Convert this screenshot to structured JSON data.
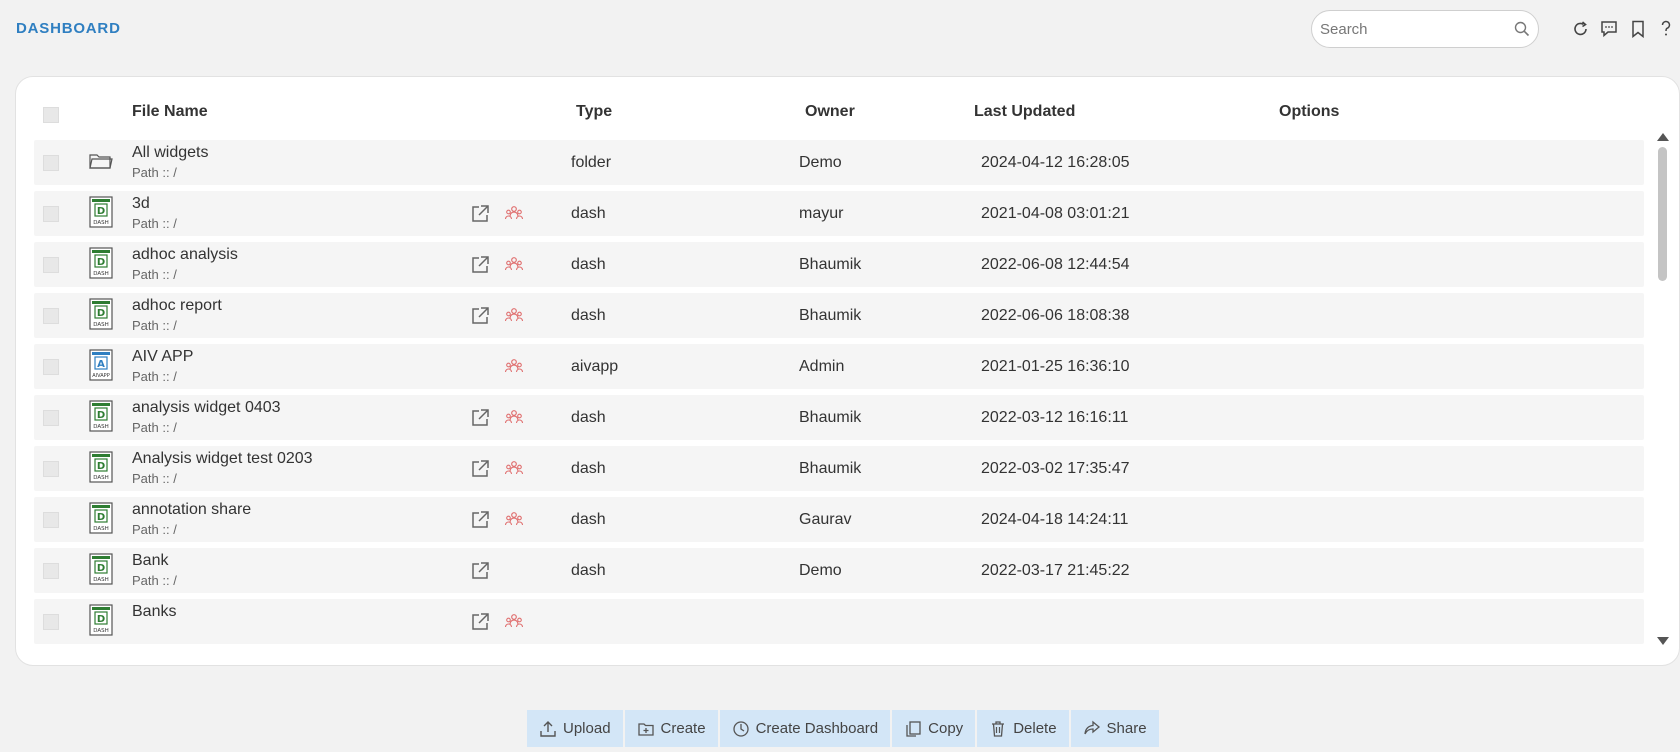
{
  "header": {
    "title": "DASHBOARD",
    "search_placeholder": "Search",
    "tools": [
      "refresh-icon",
      "comment-icon",
      "bookmark-icon",
      "help-icon"
    ]
  },
  "table": {
    "columns": {
      "file_name": "File Name",
      "type": "Type",
      "owner": "Owner",
      "last_updated": "Last Updated",
      "options": "Options"
    },
    "rows": [
      {
        "name": "All widgets",
        "path": "Path :: /",
        "type": "folder",
        "owner": "Demo",
        "updated": "2024-04-12 16:28:05",
        "icon": "folder-icon",
        "open": false,
        "share": false
      },
      {
        "name": "3d",
        "path": "Path :: /",
        "type": "dash",
        "owner": "mayur",
        "updated": "2021-04-08 03:01:21",
        "icon": "dash-file-icon",
        "open": true,
        "share": true
      },
      {
        "name": "adhoc analysis",
        "path": "Path :: /",
        "type": "dash",
        "owner": "Bhaumik",
        "updated": "2022-06-08 12:44:54",
        "icon": "dash-file-icon",
        "open": true,
        "share": true
      },
      {
        "name": "adhoc report",
        "path": "Path :: /",
        "type": "dash",
        "owner": "Bhaumik",
        "updated": "2022-06-06 18:08:38",
        "icon": "dash-file-icon",
        "open": true,
        "share": true
      },
      {
        "name": "AIV APP",
        "path": "Path :: /",
        "type": "aivapp",
        "owner": "Admin",
        "updated": "2021-01-25 16:36:10",
        "icon": "aivapp-file-icon",
        "open": false,
        "share": true
      },
      {
        "name": "analysis widget 0403",
        "path": "Path :: /",
        "type": "dash",
        "owner": "Bhaumik",
        "updated": "2022-03-12 16:16:11",
        "icon": "dash-file-icon",
        "open": true,
        "share": true
      },
      {
        "name": "Analysis widget test 0203",
        "path": "Path :: /",
        "type": "dash",
        "owner": "Bhaumik",
        "updated": "2022-03-02 17:35:47",
        "icon": "dash-file-icon",
        "open": true,
        "share": true
      },
      {
        "name": "annotation share",
        "path": "Path :: /",
        "type": "dash",
        "owner": "Gaurav",
        "updated": "2024-04-18 14:24:11",
        "icon": "dash-file-icon",
        "open": true,
        "share": true
      },
      {
        "name": "Bank",
        "path": "Path :: /",
        "type": "dash",
        "owner": "Demo",
        "updated": "2022-03-17 21:45:22",
        "icon": "dash-file-icon",
        "open": true,
        "share": false
      },
      {
        "name": "Banks",
        "path": "",
        "type": "",
        "owner": "",
        "updated": "",
        "icon": "dash-file-icon",
        "open": true,
        "share": true
      }
    ]
  },
  "actions": [
    {
      "label": "Upload",
      "icon": "upload-icon"
    },
    {
      "label": "Create",
      "icon": "create-icon"
    },
    {
      "label": "Create Dashboard",
      "icon": "create-dashboard-icon"
    },
    {
      "label": "Copy",
      "icon": "copy-icon"
    },
    {
      "label": "Delete",
      "icon": "delete-icon"
    },
    {
      "label": "Share",
      "icon": "share-icon"
    }
  ],
  "colors": {
    "title": "#2f7fc1",
    "action_bg": "#d3e6f7",
    "share_icon": "#e07070",
    "dash_icon": "#2e7d32",
    "aivapp_icon": "#2f7fc1"
  }
}
